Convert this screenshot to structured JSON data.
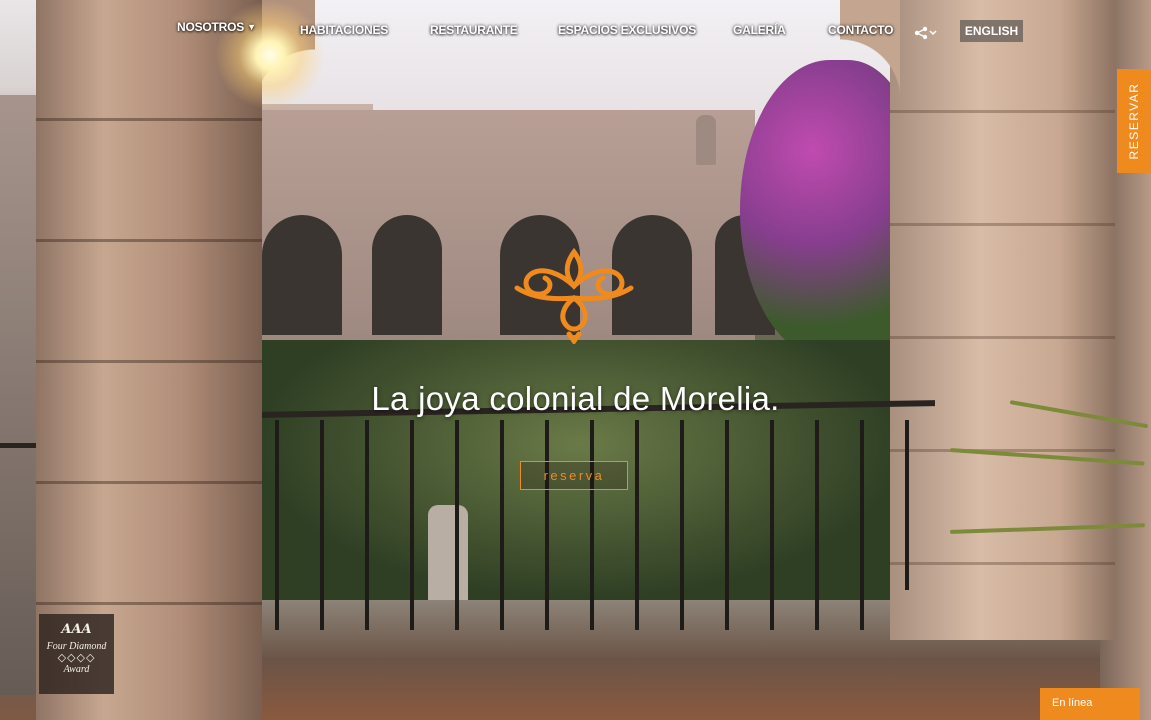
{
  "nav": {
    "items": [
      {
        "label": "NOSOTROS",
        "has_dropdown": true
      },
      {
        "label": "HABITACIONES"
      },
      {
        "label": "RESTAURANTE"
      },
      {
        "label": "ESPACIOS EXCLUSIVOS"
      },
      {
        "label": "GALERÍA"
      },
      {
        "label": "CONTACTO"
      }
    ],
    "share_icon": "share-icon",
    "language": "ENGLISH"
  },
  "side_tab": {
    "label": "RESERVAR",
    "color": "#ef8a1e"
  },
  "hero": {
    "headline": "La joya colonial de Morelia.",
    "cta_label": "reserva",
    "accent_color": "#ef8a1e"
  },
  "award": {
    "brand": "AAA",
    "line1": "Four Diamond",
    "diamonds": "◇◇◇◇",
    "line2": "Award"
  },
  "chat": {
    "label": "En línea"
  }
}
